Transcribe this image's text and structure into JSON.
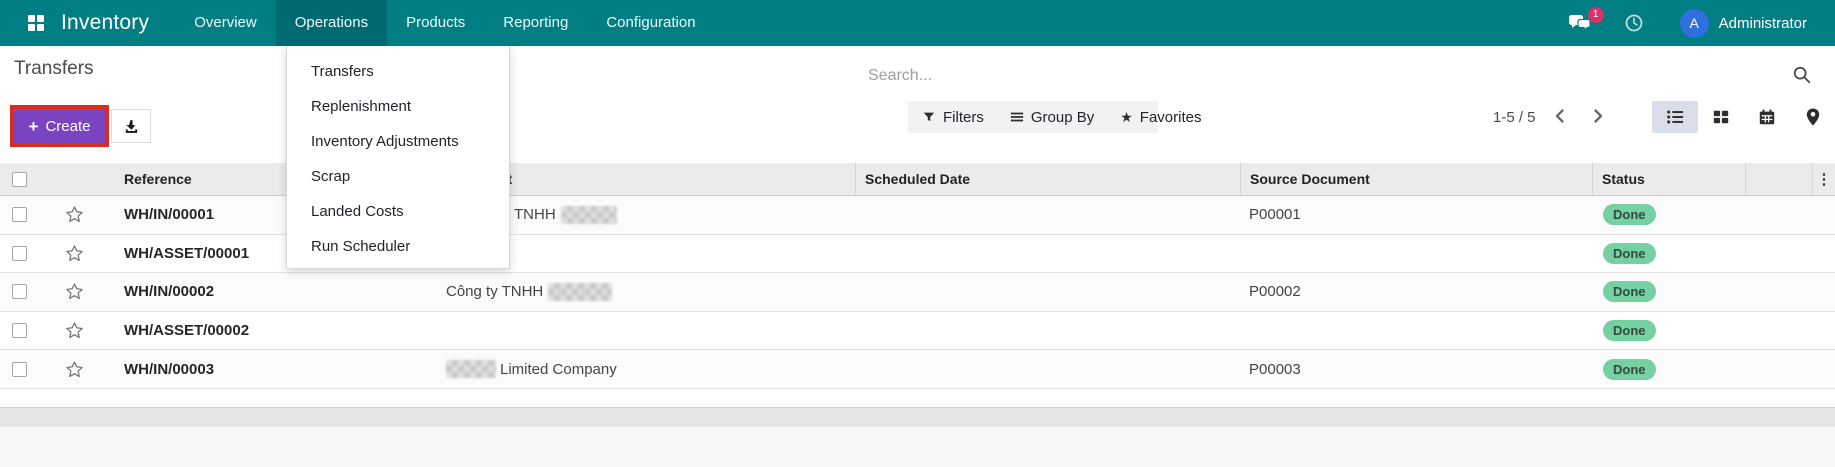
{
  "nav": {
    "app_name": "Inventory",
    "items": [
      "Overview",
      "Operations",
      "Products",
      "Reporting",
      "Configuration"
    ],
    "active_item": "Operations",
    "messages_badge": "1",
    "user_initial": "A",
    "user_name": "Administrator"
  },
  "operations_menu": {
    "items": [
      "Transfers",
      "Replenishment",
      "Inventory Adjustments",
      "Scrap",
      "Landed Costs",
      "Run Scheduler"
    ]
  },
  "page": {
    "title": "Transfers"
  },
  "toolbar": {
    "create_label": "Create"
  },
  "search": {
    "placeholder": "Search..."
  },
  "filter_bar": {
    "filters_label": "Filters",
    "group_by_label": "Group By",
    "favorites_label": "Favorites"
  },
  "pager": {
    "range_label": "1-5 / 5"
  },
  "table": {
    "columns": [
      "Reference",
      "Contact",
      "Scheduled Date",
      "Source Document",
      "Status"
    ],
    "rows": [
      {
        "reference": "WH/IN/00001",
        "contact": "TNHH",
        "scheduled_date": "",
        "source": "P00001",
        "status": "Done"
      },
      {
        "reference": "WH/ASSET/00001",
        "contact": "",
        "scheduled_date": "",
        "source": "",
        "status": "Done"
      },
      {
        "reference": "WH/IN/00002",
        "contact": "Công ty TNHH",
        "scheduled_date": "",
        "source": "P00002",
        "status": "Done"
      },
      {
        "reference": "WH/ASSET/00002",
        "contact": "",
        "scheduled_date": "",
        "source": "",
        "status": "Done"
      },
      {
        "reference": "WH/IN/00003",
        "contact": "Limited Company",
        "scheduled_date": "",
        "source": "P00003",
        "status": "Done"
      }
    ]
  },
  "colors": {
    "nav_bar": "#017e84",
    "nav_active_item": "#016a70",
    "create_button": "#7a43c0",
    "annotation_outline": "#dd2a1c",
    "status_done_bg": "#75d0a2",
    "messages_badge_bg": "#d6336c",
    "avatar_bg": "#2f6fde",
    "view_switch_active_bg": "#d9dfea"
  }
}
